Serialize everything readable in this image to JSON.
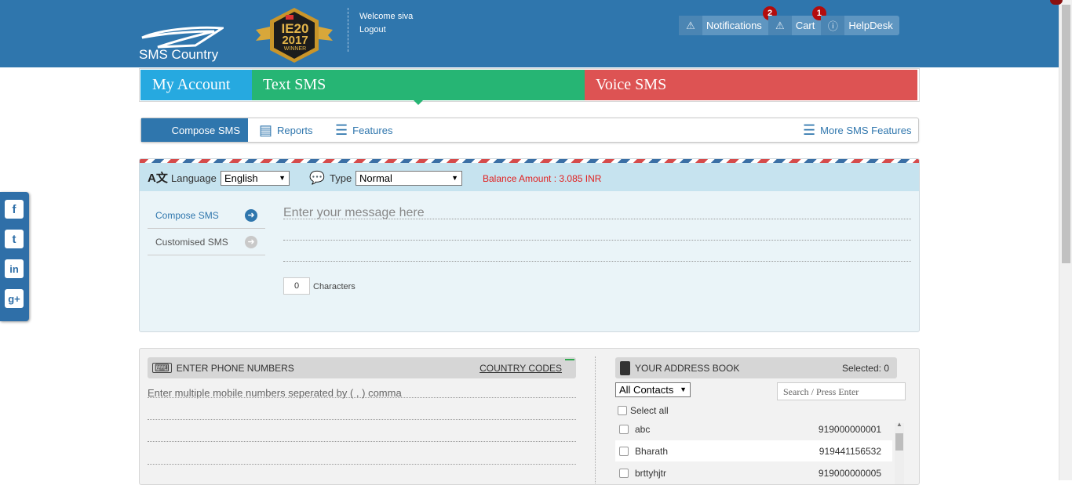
{
  "brand": {
    "logo_text": "SMS Country",
    "award_top": "IE20",
    "award_year": "2017",
    "award_sub": "WINNER"
  },
  "user": {
    "welcome": "Welcome siva",
    "logout": "Logout"
  },
  "topbar": {
    "notifications": {
      "label": "Notifications",
      "count": "2"
    },
    "cart": {
      "label": "Cart",
      "count": "1"
    },
    "helpdesk": {
      "label": "HelpDesk"
    }
  },
  "main_tabs": {
    "account": "My Account",
    "text": "Text SMS",
    "voice": "Voice SMS"
  },
  "subnav": {
    "compose": "Compose SMS",
    "reports": "Reports",
    "features": "Features",
    "more": "More SMS Features"
  },
  "compose": {
    "language_label": "Language",
    "language_value": "English",
    "type_label": "Type",
    "type_value": "Normal",
    "balance": "Balance Amount : 3.085 INR",
    "menu": [
      "Compose SMS",
      "Customised SMS"
    ],
    "placeholder": "Enter your message here",
    "char_count": "0",
    "char_label": "Characters"
  },
  "phone": {
    "title": "ENTER PHONE NUMBERS",
    "country_codes": "COUNTRY CODES",
    "placeholder": "Enter multiple mobile numbers seperated by ( , ) comma"
  },
  "addressbook": {
    "title": "YOUR ADDRESS BOOK",
    "selected": "Selected: 0",
    "filter": "All Contacts",
    "search_placeholder": "Search / Press Enter",
    "select_all": "Select all",
    "contacts": [
      {
        "name": "abc",
        "number": "919000000001"
      },
      {
        "name": "Bharath",
        "number": "919441156532"
      },
      {
        "name": "brttyhjtr",
        "number": "919000000005"
      }
    ]
  },
  "icons": [
    "warning-icon",
    "info-icon",
    "keyboard-icon",
    "address-book-icon",
    "facebook-icon",
    "twitter-icon",
    "linkedin-icon",
    "google-plus-icon",
    "language-icon",
    "chat-icon",
    "reports-icon",
    "list-icon",
    "arrow-right-icon"
  ]
}
